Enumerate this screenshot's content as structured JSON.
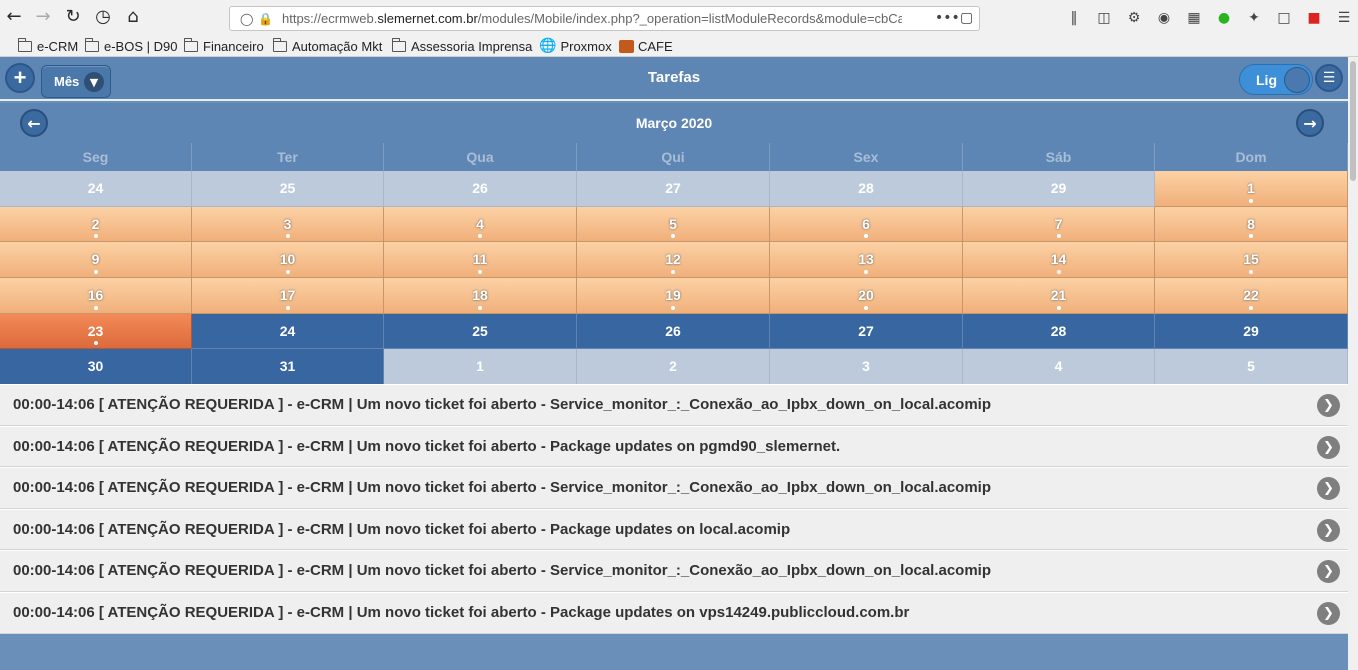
{
  "browser": {
    "url_prefix": "https://ecrmweb.",
    "url_domain": "slemernet.com.br",
    "url_rest": "/modules/Mobile/index.php?_operation=listModuleRecords&module=cbCa",
    "page_actions": "•••",
    "bookmarks": [
      {
        "label": "e-CRM",
        "type": "folder"
      },
      {
        "label": "e-BOS | D90",
        "type": "folder"
      },
      {
        "label": "Financeiro",
        "type": "folder"
      },
      {
        "label": "Automação Mkt",
        "type": "folder"
      },
      {
        "label": "Assessoria Imprensa",
        "type": "folder"
      },
      {
        "label": "Proxmox",
        "type": "link"
      },
      {
        "label": "CAFE",
        "type": "link"
      }
    ]
  },
  "header": {
    "title": "Tarefas",
    "add_label": "+",
    "view_select": "Mês",
    "toggle_label": "Lig"
  },
  "calendar": {
    "month_label": "Março 2020",
    "weekdays": [
      "Seg",
      "Ter",
      "Qua",
      "Qui",
      "Sex",
      "Sáb",
      "Dom"
    ],
    "weeks": [
      [
        {
          "d": "24",
          "s": "out"
        },
        {
          "d": "25",
          "s": "out"
        },
        {
          "d": "26",
          "s": "out"
        },
        {
          "d": "27",
          "s": "out"
        },
        {
          "d": "28",
          "s": "out"
        },
        {
          "d": "29",
          "s": "out"
        },
        {
          "d": "1",
          "s": "ev"
        }
      ],
      [
        {
          "d": "2",
          "s": "ev"
        },
        {
          "d": "3",
          "s": "ev"
        },
        {
          "d": "4",
          "s": "ev"
        },
        {
          "d": "5",
          "s": "ev"
        },
        {
          "d": "6",
          "s": "ev"
        },
        {
          "d": "7",
          "s": "ev"
        },
        {
          "d": "8",
          "s": "ev"
        }
      ],
      [
        {
          "d": "9",
          "s": "ev"
        },
        {
          "d": "10",
          "s": "ev"
        },
        {
          "d": "11",
          "s": "ev"
        },
        {
          "d": "12",
          "s": "ev"
        },
        {
          "d": "13",
          "s": "ev"
        },
        {
          "d": "14",
          "s": "ev"
        },
        {
          "d": "15",
          "s": "ev"
        }
      ],
      [
        {
          "d": "16",
          "s": "ev"
        },
        {
          "d": "17",
          "s": "ev"
        },
        {
          "d": "18",
          "s": "ev"
        },
        {
          "d": "19",
          "s": "ev"
        },
        {
          "d": "20",
          "s": "ev"
        },
        {
          "d": "21",
          "s": "ev"
        },
        {
          "d": "22",
          "s": "ev"
        }
      ],
      [
        {
          "d": "23",
          "s": "today"
        },
        {
          "d": "24",
          "s": "fut"
        },
        {
          "d": "25",
          "s": "fut"
        },
        {
          "d": "26",
          "s": "fut"
        },
        {
          "d": "27",
          "s": "fut"
        },
        {
          "d": "28",
          "s": "fut"
        },
        {
          "d": "29",
          "s": "fut"
        }
      ],
      [
        {
          "d": "30",
          "s": "fut"
        },
        {
          "d": "31",
          "s": "fut"
        },
        {
          "d": "1",
          "s": "out"
        },
        {
          "d": "2",
          "s": "out"
        },
        {
          "d": "3",
          "s": "out"
        },
        {
          "d": "4",
          "s": "out"
        },
        {
          "d": "5",
          "s": "out"
        }
      ]
    ]
  },
  "events": [
    "00:00-14:06 [ ATENÇÃO REQUERIDA ] - e-CRM | Um novo ticket foi aberto - Service_monitor_:_Conexão_ao_Ipbx_down_on_local.acomip",
    "00:00-14:06 [ ATENÇÃO REQUERIDA ] - e-CRM | Um novo ticket foi aberto - Package updates on pgmd90_slemernet.",
    "00:00-14:06 [ ATENÇÃO REQUERIDA ] - e-CRM | Um novo ticket foi aberto - Service_monitor_:_Conexão_ao_Ipbx_down_on_local.acomip",
    "00:00-14:06 [ ATENÇÃO REQUERIDA ] - e-CRM | Um novo ticket foi aberto - Package updates on local.acomip",
    "00:00-14:06 [ ATENÇÃO REQUERIDA ] - e-CRM | Um novo ticket foi aberto - Service_monitor_:_Conexão_ao_Ipbx_down_on_local.acomip",
    "00:00-14:06 [ ATENÇÃO REQUERIDA ] - e-CRM | Um novo ticket foi aberto - Package updates on vps14249.publiccloud.com.br"
  ],
  "colors": {
    "header_bg": "#5e86b4",
    "event_day": "#f5bd8a",
    "today": "#e8764a",
    "future_day": "#3766a0",
    "other_month": "#bccadb"
  }
}
